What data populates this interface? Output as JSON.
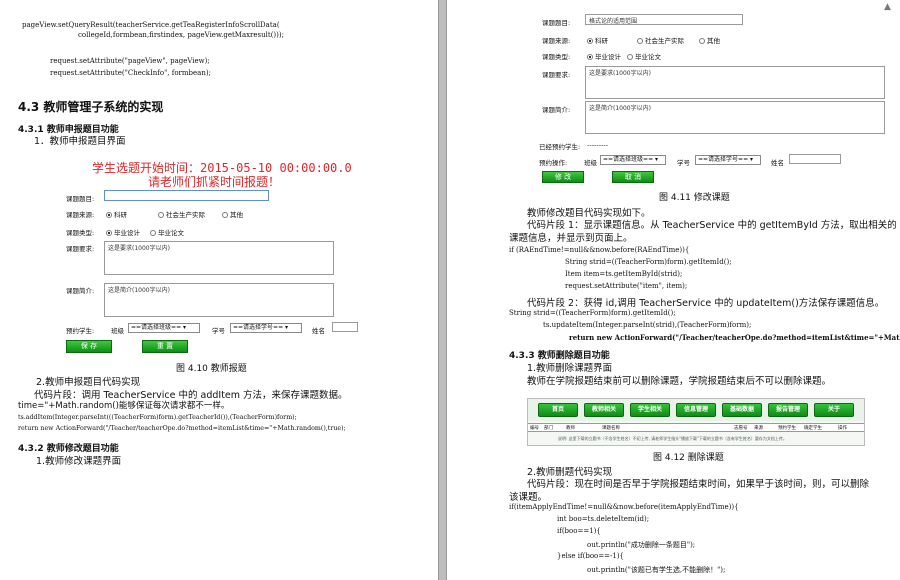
{
  "left": {
    "code_lines": [
      "pageView.setQueryResult(teacherService.getTeaRegisterInfoScrollData(",
      "collegeId,formbean,firstindex, pageView.getMaxresult()));",
      "request.setAttribute(\"pageView\", pageView);",
      "request.setAttribute(\"CheckInfo\", formbean);"
    ],
    "section_title": "4.3  教师管理子系统的实现",
    "sub1_title": "4.3.1 教师申报题目功能",
    "sub1_item": "1．教师申报题目界面",
    "banner_line1": "学生选题开始时间：2015-05-10 00:00:00.0",
    "banner_line2": "请老师们抓紧时间报题！",
    "form": {
      "title_label": "课题题目:",
      "source_label": "课题来源:",
      "source_options": [
        "科研",
        "社会生产实际",
        "其他"
      ],
      "type_label": "课题类型:",
      "type_options": [
        "毕业设计",
        "毕业论文"
      ],
      "req_label": "课题要求:",
      "req_placeholder": "这是要求(1000字以内)",
      "brief_label": "课题简介:",
      "brief_placeholder": "这是简介(1000字以内)",
      "student_label": "预约学生:",
      "class_label": "班级",
      "class_select": "==请选择班级==",
      "stuno_label": "学号",
      "stuno_select": "==请选择学号==",
      "name_label": "姓名",
      "save_btn": "保 存",
      "reset_btn": "重 置"
    },
    "fig_caption": "图 4.10 教师报题",
    "code_intro_item": "2.教师申报题目代码实现",
    "para1": "代码片段：调用 TeacherService 中的 addItem 方法，来保存课题数据。",
    "para1b": "time=\"+Math.random()能够保证每次请求都不一样。",
    "code2": "ts.addItem(Integer.parseInt(((TeacherForm)form).getTeacherId()),(TeacherForm)form);",
    "code3": "return new ActionForward(\"/Teacher/teacherOpe.do?method=itemList&time=\"+Math.random(),true);",
    "sub2_title": "4.3.2 教师修改题目功能",
    "sub2_item": "1.教师修改课题界面"
  },
  "right": {
    "form": {
      "title_label": "课题题目:",
      "title_value": "格式论的适用范围",
      "source_label": "课题来源:",
      "source_options": [
        "科研",
        "社会生产实际",
        "其他"
      ],
      "type_label": "课题类型:",
      "type_options": [
        "毕业设计",
        "毕业论文"
      ],
      "req_label": "课题要求:",
      "req_placeholder": "这是要求(1000字以内)",
      "brief_label": "课题简介:",
      "brief_placeholder": "这是简介(1000字以内)",
      "reserved_label": "已经预约学生:",
      "reserved_value": "---------",
      "op_label": "预约操作:",
      "class_label": "班级",
      "class_select": "==请选择班级==",
      "stuno_label": "学号",
      "stuno_select": "==请选择学号==",
      "name_label": "姓名",
      "modify_btn": "修 改",
      "cancel_btn": "取 消"
    },
    "fig_caption": "图 4.11 修改课题",
    "p_intro": "教师修改题目代码实现如下。",
    "p_frag1a": "代码片段 1：显示课题信息。从 TeacherService 中的 getItemById 方法，取出相关的",
    "p_frag1b": "课题信息，并显示到页面上。",
    "c1": "if (RAEndTime!=null&&now.before(RAEndTime)){",
    "c2": "String strid=((TeacherForm)form).getItemId();",
    "c3": "Item item=ts.getItemById(strid);",
    "c4": "request.setAttribute(\"item\", item);",
    "p_frag2": "代码片段 2：获得 id,调用 TeacherService 中的 updateItem()方法保存课题信息。",
    "c5": "String strid=((TeacherForm)form).getItemId();",
    "c6": "ts.updateItem(Integer.parseInt(strid),(TeacherForm)form);",
    "c7": "return new ActionForward(\"/Teacher/teacherOpe.do?method=itemList&time=\"+Math.random(),true);",
    "sub3_title": "4.3.3 教师删除题目功能",
    "sub3_item": "1.教师删除课题界面",
    "p_del": "教师在学院报题结束前可以删除课题，学院报题结束后不可以删除课题。",
    "nav": [
      "首页",
      "教师相关",
      "学生相关",
      "信息管理",
      "基础数据",
      "报告管理",
      "关于"
    ],
    "table_headers": [
      "编号",
      "部门",
      "教师",
      "课题名称",
      "志愿号",
      "来源",
      "预约学生",
      "确定学生",
      "操作"
    ],
    "table_note": "说明: 这里下载的立题书（不含学生姓名）不初上传, 请老师学生指头\"播放下载\"下载的立题书（含有学生姓名）要存为文档上传。",
    "fig_caption2": "图 4.12  删除课题",
    "del_code_item": "2.教师删题代码实现",
    "p_del_frag_a": "代码片段：现在时间是否早于学院报题结束时间，如果早于该时间，则，可以删除",
    "p_del_frag_b": "该课题。",
    "d1": "if(itemApplyEndTime!=null&&now.before(itemApplyEndTime)){",
    "d2": "int boo=ts.deleteItem(id);",
    "d3": "if(boo==1){",
    "d4": "out.println(\"成功删除一条题目\");",
    "d5": "}else if(boo==-1){",
    "d6": "out.println(\"该题已有学生选,不能删除！\");"
  }
}
